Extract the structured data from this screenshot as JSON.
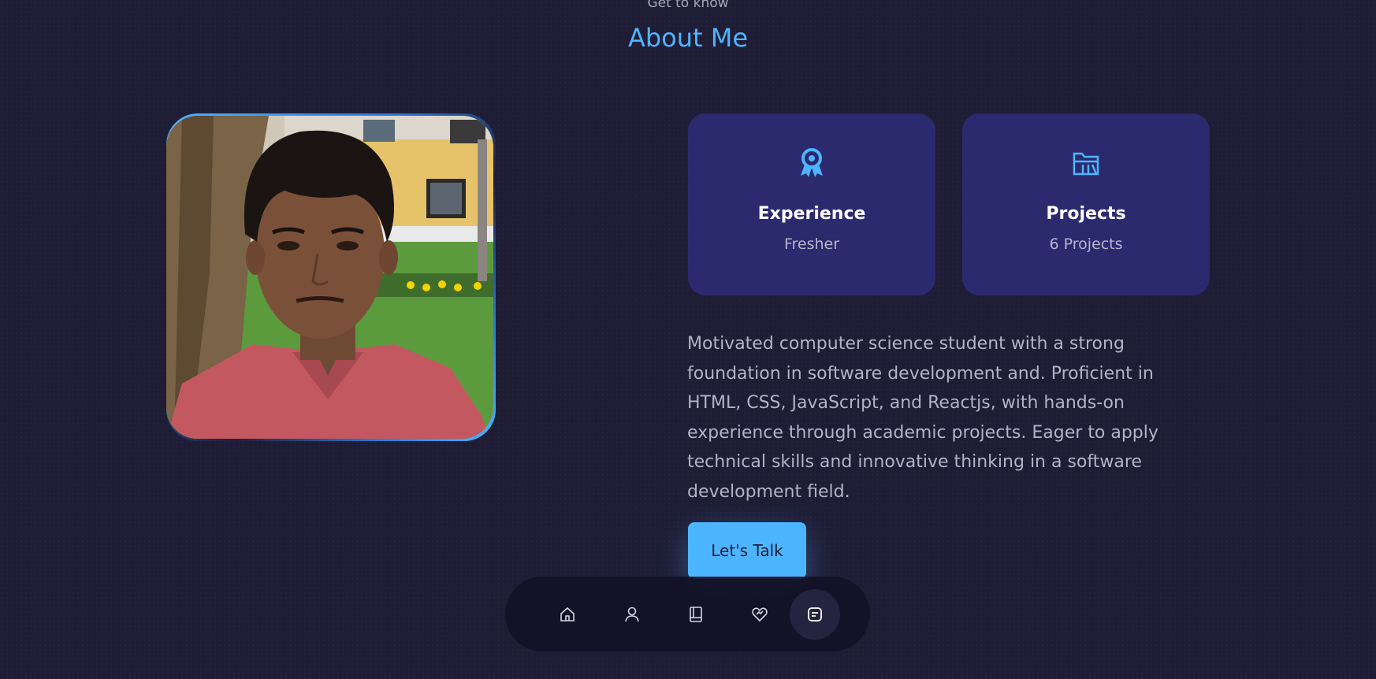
{
  "section": {
    "subtitle": "Get to know",
    "title": "About Me"
  },
  "cards": [
    {
      "icon": "award-icon",
      "title": "Experience",
      "value": "Fresher"
    },
    {
      "icon": "folder-icon",
      "title": "Projects",
      "value": "6 Projects"
    }
  ],
  "about_text": "Motivated computer science student with a strong foundation in software development and. Proficient in HTML, CSS, JavaScript, and Reactjs, with hands-on experience through academic projects. Eager to apply technical skills and innovative thinking in a software development field.",
  "cta": {
    "label": "Let's Talk"
  },
  "nav": {
    "items": [
      {
        "icon": "home-icon",
        "active": false
      },
      {
        "icon": "user-icon",
        "active": false
      },
      {
        "icon": "book-icon",
        "active": false
      },
      {
        "icon": "services-icon",
        "active": false
      },
      {
        "icon": "message-icon",
        "active": true
      }
    ]
  },
  "colors": {
    "background": "#1f1d36",
    "accent": "#4db5ff",
    "card": "#2c2a6e",
    "text_muted": "#b4b2c6"
  }
}
